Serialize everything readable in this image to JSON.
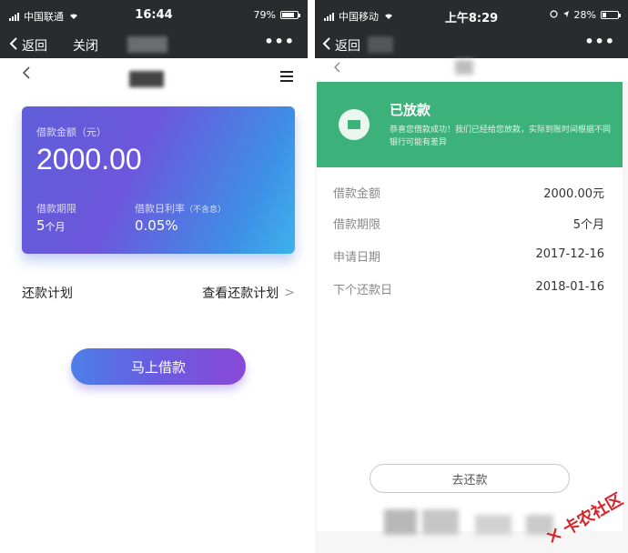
{
  "left": {
    "status": {
      "carrier": "中国联通",
      "time": "16:44",
      "battery": "79%",
      "battery_level": 0.79
    },
    "nav": {
      "back_label": "返回",
      "close_label": "关闭",
      "more_label": "•••"
    },
    "card": {
      "amount_label": "借款金额（元）",
      "amount": "2000.00",
      "term_label": "借款期限",
      "term_num": "5",
      "term_unit": "个月",
      "rate_label": "借款日利率",
      "rate_hint": "（不含息）",
      "rate": "0.05%"
    },
    "plan": {
      "label": "还款计划",
      "link": "查看还款计划",
      "arrow": ">"
    },
    "borrow_button": "马上借款"
  },
  "right": {
    "status": {
      "carrier": "中国移动",
      "time": "上午8:29",
      "battery": "28%",
      "battery_level": 0.28
    },
    "nav": {
      "back_label": "返回",
      "more_label": "•••"
    },
    "success": {
      "title": "已放款",
      "desc": "恭喜您借款成功！我们已经给您放款，实际到账时间根据不同银行可能有差异"
    },
    "details": [
      {
        "key": "借款金额",
        "value": "2000.00元"
      },
      {
        "key": "借款期限",
        "value": "5个月"
      },
      {
        "key": "申请日期",
        "value": "2017-12-16"
      },
      {
        "key": "下个还款日",
        "value": "2018-01-16"
      }
    ],
    "repay_button": "去还款"
  },
  "watermark": {
    "icon": "✕",
    "text": "卡农社区"
  }
}
